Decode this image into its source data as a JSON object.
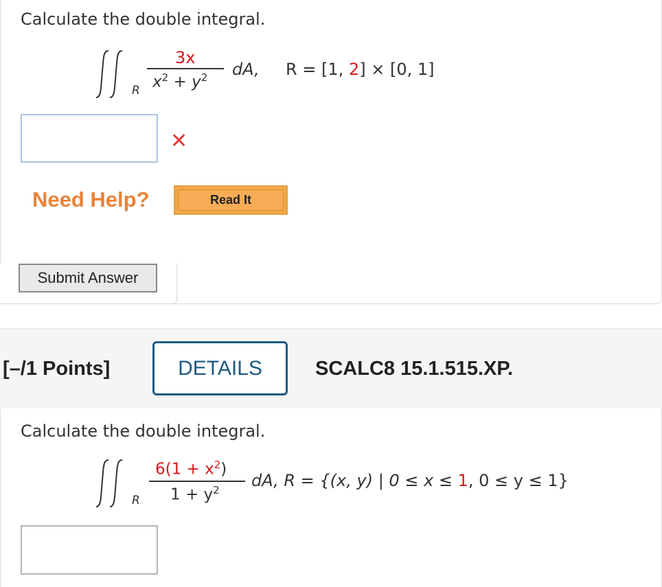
{
  "q1": {
    "prompt": "Calculate the double integral.",
    "region_sub": "R",
    "numerator": "3x",
    "den_x": "x",
    "den_plus": " + ",
    "den_y": "y",
    "exp2": "2",
    "dA": "dA,",
    "region_prefix": "R = [1, ",
    "region_highlight": "2",
    "region_suffix": "] × [0, 1]",
    "answer_value": "",
    "status_icon": "x-mark-icon",
    "status_color": "#e23a3a"
  },
  "help": {
    "label": "Need Help?",
    "read_it": "Read It"
  },
  "submit_label": "Submit Answer",
  "q2_header": {
    "points": "[–/1 Points]",
    "details": "DETAILS",
    "code": "SCALC8 15.1.515.XP."
  },
  "q2": {
    "prompt": "Calculate the double integral.",
    "region_sub": "R",
    "num_prefix": "6(1 + x",
    "num_suffix": ")",
    "den_prefix": "1 + y",
    "exp2": "2",
    "dA": "dA, R = {(x, y) | 0 ≤ x ≤ ",
    "region_highlight": "1",
    "region_suffix": ", 0 ≤ y ≤ 1}",
    "answer_value": ""
  },
  "colors": {
    "help_orange": "#e8833a",
    "details_blue": "#1d5a83",
    "highlight_red": "#d7191c"
  }
}
